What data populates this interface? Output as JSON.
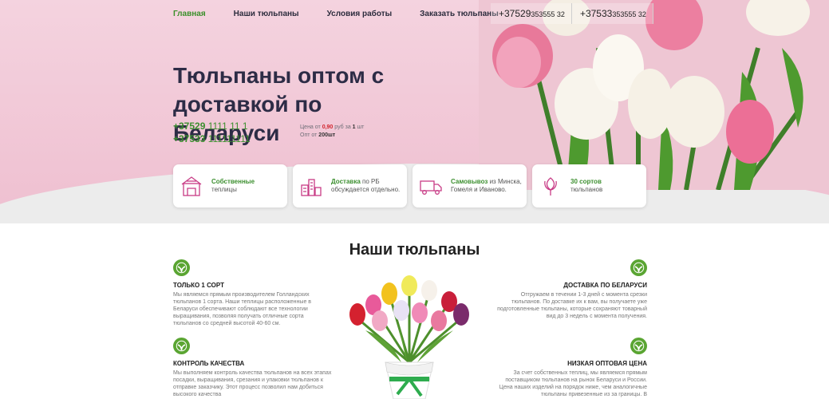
{
  "nav": {
    "items": [
      "Главная",
      "Наши тюльпаны",
      "Условия работы",
      "Заказать тюльпаны"
    ]
  },
  "top_phones": [
    {
      "prefix": "+37529",
      "number": "353555 32"
    },
    {
      "prefix": "+37533",
      "number": "353555 32"
    }
  ],
  "hero": {
    "title": "Тюльпаны оптом с доставкой по Беларуси",
    "phone1_prefix": "+37529",
    "phone1_number": "1111 11 1",
    "phone2_prefix": "+37533",
    "phone2_number": "111111111",
    "price_label": "Цена от",
    "price_value": "0,90",
    "price_unit": "руб за",
    "price_qty": "1",
    "price_qty_unit": "шт",
    "opt_label": "Опт от",
    "opt_value": "200шт"
  },
  "cards": [
    {
      "accent": "Собственные",
      "rest": "теплицы",
      "icon": "greenhouse-icon"
    },
    {
      "accent": "Доставка",
      "rest": "по РБ обсуждается отдельно.",
      "icon": "city-icon"
    },
    {
      "accent": "Самовывоз",
      "rest": "из Минска, Гомеля и Иваново.",
      "icon": "truck-icon"
    },
    {
      "accent": "30 сортов",
      "rest": "тюльпанов",
      "icon": "tulip-icon"
    }
  ],
  "section": {
    "title": "Наши тюльпаны",
    "features": [
      {
        "title": "ТОЛЬКО 1 СОРТ",
        "text": "Мы являемся прямым производителем Голландских тюльпанов 1 сорта. Наши теплицы расположенные в Беларуси обеспечивают соблюдают все технологии выращивания, позволяя получать отличные сорта тюльпанов со средней высотой 40-60 см."
      },
      {
        "title": "КОНТРОЛЬ КАЧЕСТВА",
        "text": "Мы выполняем контроль качества тюльпанов на всех этапах посадки, выращивания, срезания и упаковки тюльпанов к отправке заказчику. Этот процесс позволил нам добиться высокого качества"
      },
      {
        "title": "ДОСТАВКА ПО БЕЛАРУСИ",
        "text": "Отгружаем в течении 1-3 дней с момента срезки тюльпанов. По доставке их к вам, вы получаете уже подготовленные тюльпаны, которые сохраняют товарный вид до 3 недель с момента получения."
      },
      {
        "title": "НИЗКАЯ ОПТОВАЯ ЦЕНА",
        "text": "За счет собственных теплиц, мы являемся прямым поставщиком тюльпанов на рынок Беларуси и России. Цена наших изделий на порядок ниже, чем аналогичные тюльпаны привезенные из за границы. В"
      }
    ]
  },
  "colors": {
    "accent_green": "#3c8f2f",
    "price_red": "#d1262e",
    "hero_pink": "#f1c7d6"
  }
}
